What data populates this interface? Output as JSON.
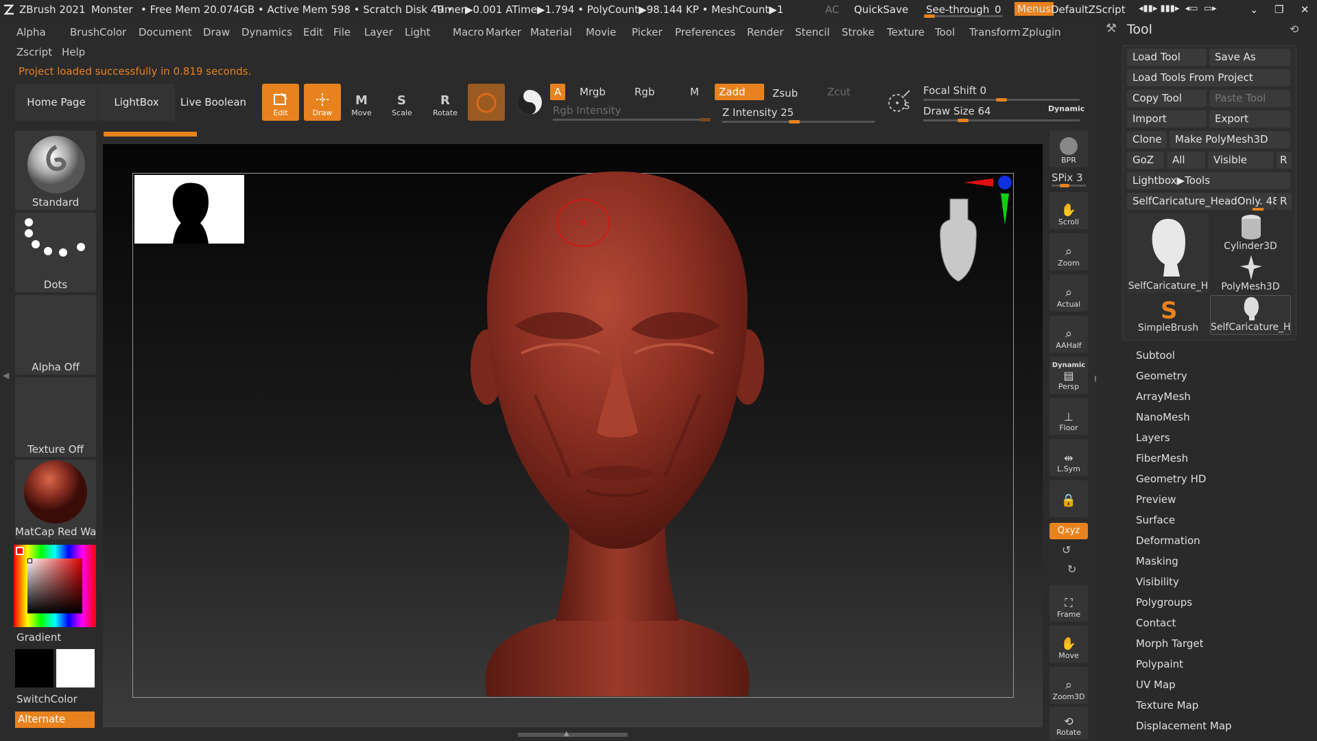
{
  "titlebar": {
    "app": "ZBrush 2021",
    "doc": "Monster",
    "stats": "• Free Mem 20.074GB • Active Mem 598 • Scratch Disk 49 •",
    "timer": "Timer▶0.001 ATime▶1.794 • PolyCount▶98.144 KP • MeshCount▶1",
    "ac": "AC",
    "quicksave": "QuickSave",
    "see_through": "See-through",
    "see_through_value": "0",
    "menus": "Menus",
    "script": "DefaultZScript"
  },
  "menus": [
    "Alpha",
    "Brush",
    "Color",
    "Document",
    "Draw",
    "Dynamics",
    "Edit",
    "File",
    "Layer",
    "Light",
    "Macro",
    "Marker",
    "Material",
    "Movie",
    "Picker",
    "Preferences",
    "Render",
    "Stencil",
    "Stroke",
    "Texture",
    "Tool",
    "Transform",
    "Zplugin"
  ],
  "menus_row2": [
    "Zscript",
    "Help"
  ],
  "status": "Project loaded successfully in 0.819 seconds.",
  "toolbar": {
    "home": "Home Page",
    "lightbox": "LightBox",
    "live_boolean": "Live Boolean",
    "edit": "Edit",
    "draw": "Draw",
    "move": "Move",
    "scale": "Scale",
    "rotate": "Rotate",
    "a": "A",
    "mrgb": "Mrgb",
    "rgb": "Rgb",
    "m": "M",
    "zadd": "Zadd",
    "zsub": "Zsub",
    "zcut": "Zcut",
    "rgb_intensity": "Rgb Intensity",
    "z_intensity": "Z Intensity 25",
    "focal_shift": "Focal Shift 0",
    "draw_size": "Draw Size 64",
    "dynamic": "Dynamic",
    "s": "S"
  },
  "shelf": {
    "standard": "Standard",
    "dots": "Dots",
    "alpha": "Alpha Off",
    "texture": "Texture Off",
    "material": "MatCap Red Wax",
    "gradient": "Gradient",
    "switchcolor": "SwitchColor",
    "alternate": "Alternate"
  },
  "right_shelf": {
    "bpr": "BPR",
    "spix": "SPix 3",
    "scroll": "Scroll",
    "zoom": "Zoom",
    "actual": "Actual",
    "aahalf": "AAHalf",
    "dynamic": "Dynamic",
    "persp": "Persp",
    "floor": "Floor",
    "lsym": "L.Sym",
    "xyz": "Qxyz",
    "frame": "Frame",
    "move": "Move",
    "zoom3d": "Zoom3D",
    "rotate": "Rotate"
  },
  "palette": {
    "title": "Tool",
    "load_tool": "Load Tool",
    "save_as": "Save As",
    "load_from_project": "Load Tools From Project",
    "copy_tool": "Copy Tool",
    "paste_tool": "Paste Tool",
    "import": "Import",
    "export": "Export",
    "clone": "Clone",
    "make_polymesh": "Make PolyMesh3D",
    "goz": "GoZ",
    "all": "All",
    "visible": "Visible",
    "r": "R",
    "lightbox_tools": "Lightbox▶Tools",
    "current_tool": "SelfCaricature_HeadOnly. 48",
    "thumbs": [
      "SelfCaricature_H",
      "Cylinder3D",
      "PolyMesh3D",
      "SimpleBrush",
      "SelfCaricature_H"
    ],
    "subpalettes": [
      "Subtool",
      "Geometry",
      "ArrayMesh",
      "NanoMesh",
      "Layers",
      "FiberMesh",
      "Geometry HD",
      "Preview",
      "Surface",
      "Deformation",
      "Masking",
      "Visibility",
      "Polygroups",
      "Contact",
      "Morph Target",
      "Polypaint",
      "UV Map",
      "Texture Map",
      "Displacement Map"
    ]
  },
  "colors": {
    "accent": "#e8821e",
    "mesh": "#8a2e22",
    "background": "#2b2b2b"
  }
}
